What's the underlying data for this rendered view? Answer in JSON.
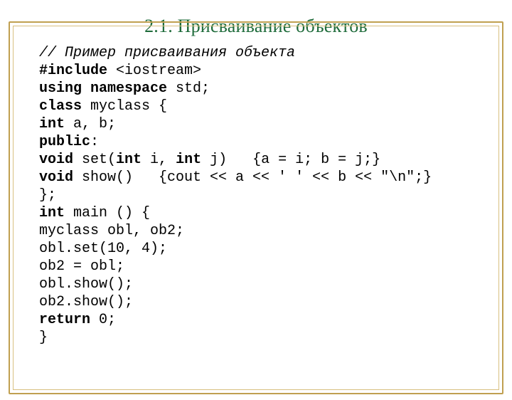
{
  "title": "2.1. Присваивание объектов",
  "code": {
    "comment": "// Пример присваивания объекта",
    "l1a": "#include ",
    "l1b": "<iostream>",
    "l2a": "using namespace ",
    "l2b": "std;",
    "l3a": "class ",
    "l3b": "myclass {",
    "l4a": "int ",
    "l4b": "a, b;",
    "l5a": "public",
    "l5b": ":",
    "l6a": "void ",
    "l6b": "set(",
    "l6c": "int ",
    "l6d": "i, ",
    "l6e": "int ",
    "l6f": "j)   {a = i; b = j;}",
    "l7a": "void ",
    "l7b": "show()   {cout << a << ' ' << b << \"\\n\";}",
    "l8": "};",
    "l9a": "int ",
    "l9b": "main () {",
    "l10": "myclass obl, ob2;",
    "l11": "obl.set(10, 4);",
    "l12": "ob2 = obl;",
    "l13": "obl.show();",
    "l14": "ob2.show();",
    "l15a": "return ",
    "l15b": "0;",
    "l16": "}"
  }
}
